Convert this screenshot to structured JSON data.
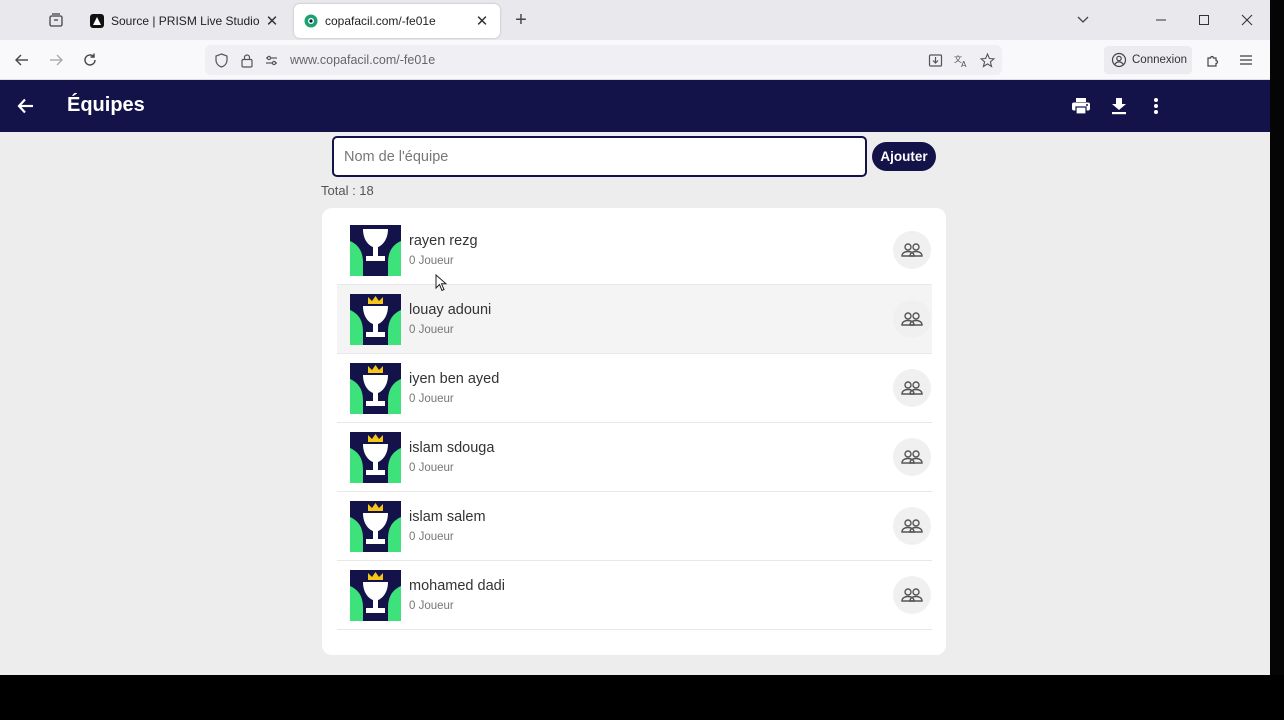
{
  "browser": {
    "tabs": [
      {
        "title": "Source | PRISM Live Studio",
        "active": false
      },
      {
        "title": "copafacil.com/-fe01e",
        "active": true
      }
    ],
    "url": "www.copafacil.com/-fe01e",
    "signin_label": "Connexion"
  },
  "app": {
    "title": "Équipes",
    "accent_color": "#13134a",
    "team_input": {
      "placeholder": "Nom de l'équipe",
      "value": ""
    },
    "add_label": "Ajouter",
    "total_label": "Total : 18",
    "teams": [
      {
        "name": "rayen rezg",
        "players": "0 Joueur"
      },
      {
        "name": "louay adouni",
        "players": "0 Joueur"
      },
      {
        "name": "iyen ben ayed",
        "players": "0 Joueur"
      },
      {
        "name": "islam sdouga",
        "players": "0 Joueur"
      },
      {
        "name": "islam salem",
        "players": "0 Joueur"
      },
      {
        "name": "mohamed dadi",
        "players": "0 Joueur"
      }
    ]
  }
}
